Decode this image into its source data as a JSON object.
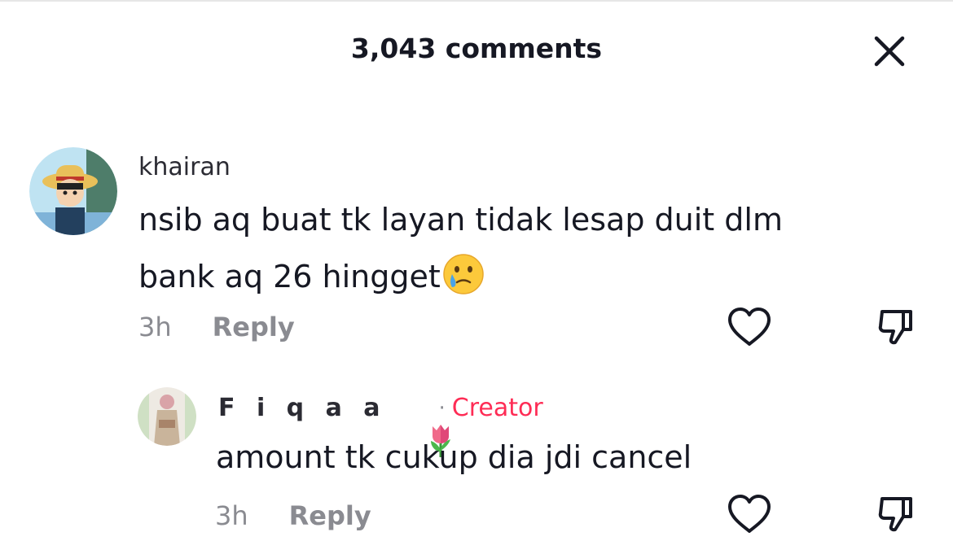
{
  "header": {
    "title": "3,043 comments",
    "close_icon": "close-icon"
  },
  "comments": [
    {
      "username": "khairan",
      "text": "nsib aq buat tk layan tidak lesap duit dlm bank aq 26 hingget",
      "emoji": "crying-face-emoji",
      "time": "3h",
      "reply_label": "Reply",
      "avatar": "anime-character-avatar",
      "like_icon": "heart-outline-icon",
      "dislike_icon": "thumbs-down-icon"
    }
  ],
  "replies": [
    {
      "username": "F i q a a",
      "emoji": "tulip-emoji",
      "separator": "·",
      "badge": "Creator",
      "text": "amount tk cukup dia jdi cancel",
      "time": "3h",
      "reply_label": "Reply",
      "avatar": "user-photo-avatar",
      "like_icon": "heart-outline-icon",
      "dislike_icon": "thumbs-down-icon"
    }
  ],
  "colors": {
    "text": "#161823",
    "secondary": "#8a8b91",
    "creator_badge": "#fe2c55"
  }
}
